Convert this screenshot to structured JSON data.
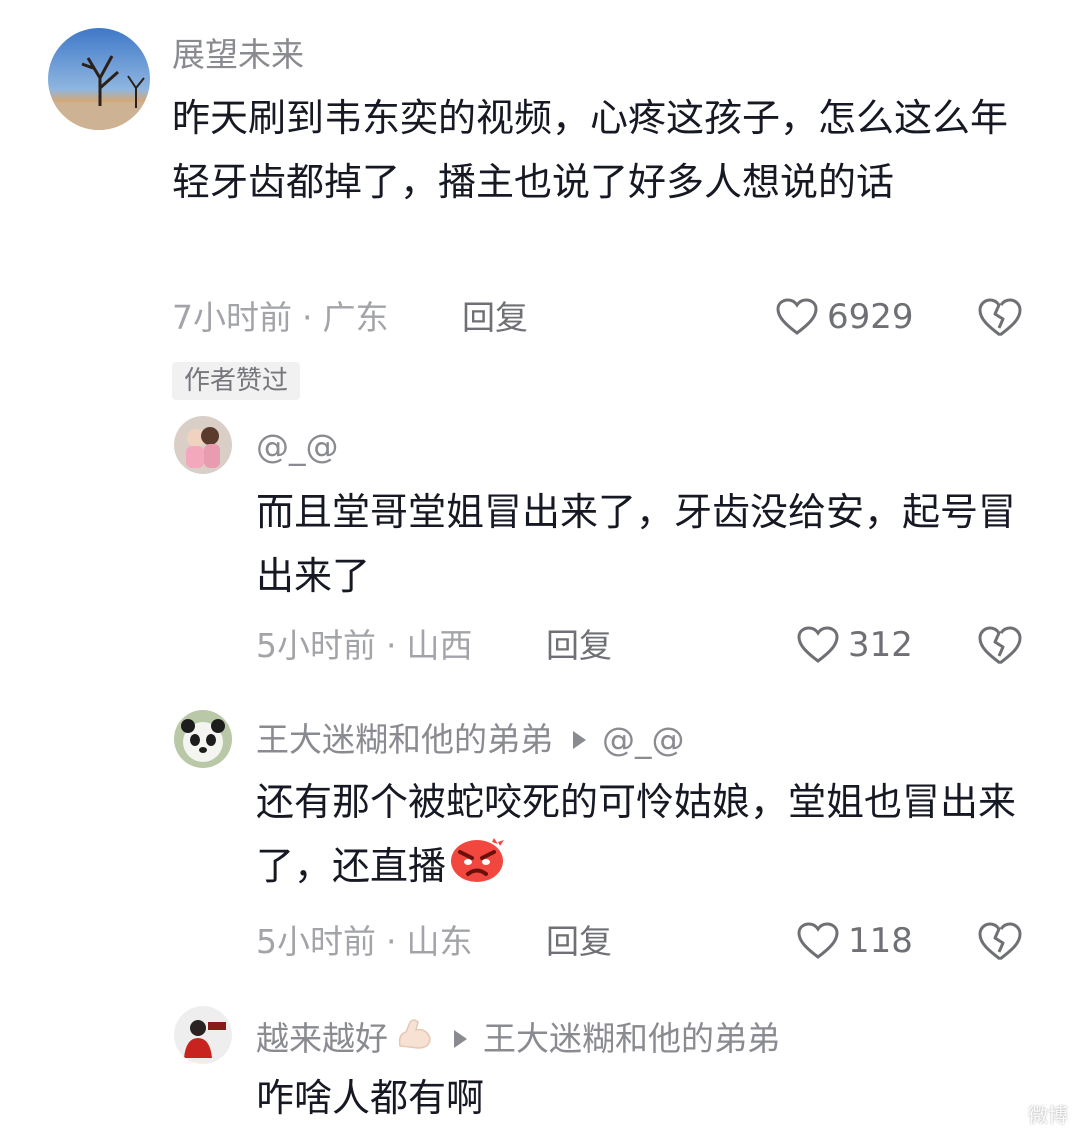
{
  "comments": [
    {
      "username": "展望未来",
      "text": "昨天刷到韦东奕的视频，心疼这孩子，怎么这么年轻牙齿都掉了，播主也说了好多人想说的话",
      "time": "7小时前",
      "location": "广东",
      "reply_label": "回复",
      "likes": "6929",
      "badge": "作者赞过"
    },
    {
      "username": "@_@",
      "text": "而且堂哥堂姐冒出来了，牙齿没给安，起号冒出来了",
      "time": "5小时前",
      "location": "山西",
      "reply_label": "回复",
      "likes": "312"
    },
    {
      "username": "王大迷糊和他的弟弟",
      "reply_to": "@_@",
      "text": "还有那个被蛇咬死的可怜姑娘，堂姐也冒出来了，还直播",
      "emoji": "angry-face",
      "time": "5小时前",
      "location": "山东",
      "reply_label": "回复",
      "likes": "118"
    },
    {
      "username": "越来越好",
      "username_emoji": "flexed-biceps",
      "reply_to": "王大迷糊和他的弟弟",
      "text": "咋啥人都有啊"
    }
  ],
  "colors": {
    "text": "#161823",
    "secondary": "#8a8b91",
    "badge_bg": "#f1f1f2"
  }
}
